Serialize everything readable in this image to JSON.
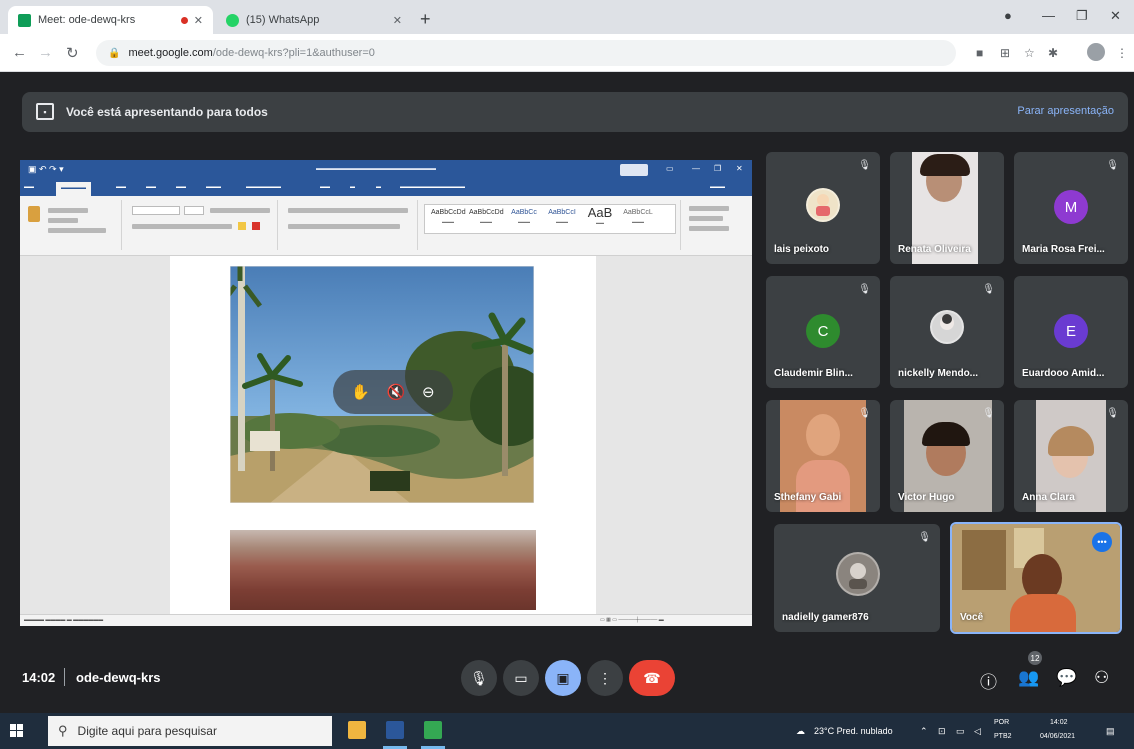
{
  "browser": {
    "tabs": [
      {
        "title": "Meet: ode-dewq-krs",
        "favicon_color": "#0f9d58",
        "active": true
      },
      {
        "title": "(15) WhatsApp",
        "favicon_color": "#25d366",
        "active": false
      }
    ],
    "url_host": "meet.google.com",
    "url_path": "/ode-dewq-krs?pli=1&authuser=0"
  },
  "presenting_bar": {
    "message": "Você está apresentando para todos",
    "stop_label": "Parar apresentação"
  },
  "participants": [
    {
      "name": "lais peixoto",
      "avatar": "image"
    },
    {
      "name": "Renata Oliveira",
      "avatar": "video"
    },
    {
      "name": "Maria Rosa Frei...",
      "avatar": "letter",
      "letter": "M",
      "color": "#8e3ad1"
    },
    {
      "name": "Claudemir Blin...",
      "avatar": "letter",
      "letter": "C",
      "color": "#2e8b2e"
    },
    {
      "name": "nickelly Mendo...",
      "avatar": "image"
    },
    {
      "name": "Euardooo Amid...",
      "avatar": "letter",
      "letter": "E",
      "color": "#6a3bd1"
    },
    {
      "name": "Sthefany Gabi",
      "avatar": "video"
    },
    {
      "name": "Victor Hugo",
      "avatar": "video"
    },
    {
      "name": "Anna Clara",
      "avatar": "video"
    },
    {
      "name": "nadielly gamer876",
      "avatar": "image"
    },
    {
      "name": "Você",
      "avatar": "video"
    }
  ],
  "bottom_bar": {
    "time": "14:02",
    "meeting_code": "ode-dewq-krs",
    "participant_count": "12"
  },
  "taskbar": {
    "search_placeholder": "Digite aqui para pesquisar",
    "weather": "23°C  Pred. nublado",
    "language": "POR",
    "keyboard": "PTB2",
    "time": "14:02",
    "date": "04/06/2021"
  },
  "colors": {
    "meet_bg": "#202124",
    "tile_bg": "#3c4043",
    "accent_blue": "#8ab4f8",
    "end_call_red": "#ea4335",
    "word_blue": "#2b579a"
  }
}
